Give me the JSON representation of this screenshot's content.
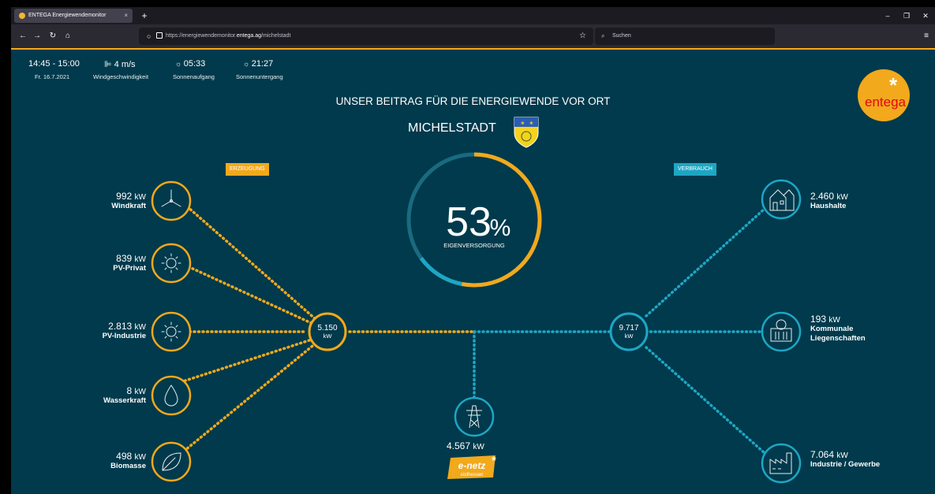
{
  "browser": {
    "tab_title": "ENTEGA Energiewendemonitor",
    "tab_close": "×",
    "new_tab": "+",
    "url_prefix": "https://energiewendemonitor.",
    "url_domain": "entega.ag",
    "url_suffix": "/michelstadt",
    "search_placeholder": "Suchen"
  },
  "header": {
    "time": "14:45 - 15:00",
    "date": "Fr. 16.7.2021",
    "wind_speed": "4 m/s",
    "wind_label": "Windgeschwindigkeit",
    "sunrise": "05:33",
    "sunrise_label": "Sonnenaufgang",
    "sunset": "21:27",
    "sunset_label": "Sonnenuntergang"
  },
  "brand": {
    "logo_text": "entega",
    "colors": {
      "accent": "#f2a91c",
      "consumption": "#1ea6c4",
      "background": "#003a4c"
    }
  },
  "title": {
    "line1": "UNSER BEITRAG FÜR DIE ENERGIEWENDE VOR ORT",
    "city": "MICHELSTADT"
  },
  "gauge": {
    "percent_value": 0.53,
    "value": "53",
    "unit": "%",
    "label": "EIGENVERSORGUNG"
  },
  "generation": {
    "tag": "ERZEUGUNG",
    "total_value": "5.150",
    "total_unit": "kW",
    "sources": [
      {
        "value": "992",
        "unit": "kW",
        "name": "Windkraft",
        "icon": "wind-turbine-icon"
      },
      {
        "value": "839",
        "unit": "kW",
        "name": "PV-Privat",
        "icon": "sun-icon"
      },
      {
        "value": "2.813",
        "unit": "kW",
        "name": "PV-Industrie",
        "icon": "sun-icon"
      },
      {
        "value": "8",
        "unit": "kW",
        "name": "Wasserkraft",
        "icon": "water-drop-icon"
      },
      {
        "value": "498",
        "unit": "kW",
        "name": "Biomasse",
        "icon": "leaf-icon"
      }
    ]
  },
  "consumption": {
    "tag": "VERBRAUCH",
    "total_value": "9.717",
    "total_unit": "kW",
    "sinks": [
      {
        "value": "2.460",
        "unit": "kW",
        "name_line1": "Haushalte",
        "name_line2": "",
        "icon": "houses-icon"
      },
      {
        "value": "193",
        "unit": "kW",
        "name_line1": "Kommunale",
        "name_line2": "Liegenschaften",
        "icon": "municipal-building-icon"
      },
      {
        "value": "7.064",
        "unit": "kW",
        "name_line1": "Industrie / Gewerbe",
        "name_line2": "",
        "icon": "factory-icon"
      }
    ]
  },
  "grid": {
    "value": "4.567",
    "unit": "kW",
    "icon": "power-pylon-icon",
    "provider_logo": "e-netz",
    "provider_sub": "südhessen"
  }
}
